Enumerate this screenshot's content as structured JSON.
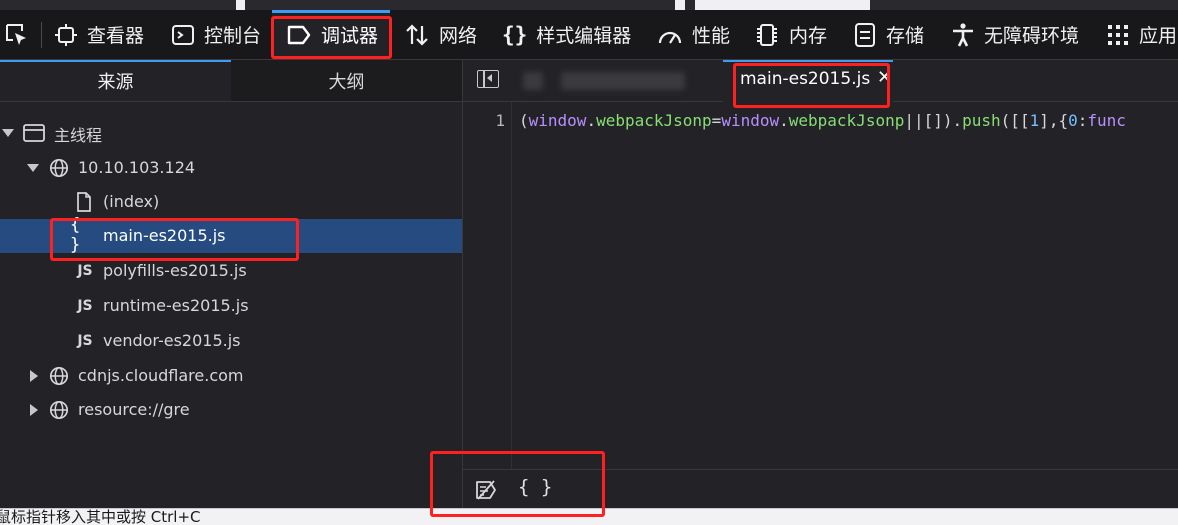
{
  "toolbar": {
    "tabs": [
      {
        "label": "查看器",
        "icon": "inspector-icon"
      },
      {
        "label": "控制台",
        "icon": "console-icon"
      },
      {
        "label": "调试器",
        "icon": "debugger-icon",
        "selected": true
      },
      {
        "label": "网络",
        "icon": "network-icon"
      },
      {
        "label": "样式编辑器",
        "icon": "style-editor-icon"
      },
      {
        "label": "性能",
        "icon": "performance-icon"
      },
      {
        "label": "内存",
        "icon": "memory-icon"
      },
      {
        "label": "存储",
        "icon": "storage-icon"
      },
      {
        "label": "无障碍环境",
        "icon": "accessibility-icon"
      },
      {
        "label": "应用",
        "icon": "application-icon"
      }
    ],
    "accent_color": "#3e9cf4"
  },
  "left_panel": {
    "tabs": [
      {
        "label": "来源",
        "active": true
      },
      {
        "label": "大纲",
        "active": false
      }
    ],
    "tree": [
      {
        "label": "主线程",
        "icon": "window-icon",
        "expanded": true
      },
      {
        "label": "10.10.103.124",
        "icon": "globe-icon",
        "expanded": true
      },
      {
        "label": "(index)",
        "icon": "file-icon"
      },
      {
        "label": "main-es2015.js",
        "icon": "braces-icon",
        "selected": true
      },
      {
        "label": "polyfills-es2015.js",
        "icon": "js-icon"
      },
      {
        "label": "runtime-es2015.js",
        "icon": "js-icon"
      },
      {
        "label": "vendor-es2015.js",
        "icon": "js-icon"
      },
      {
        "label": "cdnjs.cloudflare.com",
        "icon": "globe-icon",
        "expanded": false
      },
      {
        "label": "resource://gre",
        "icon": "globe-icon",
        "expanded": false
      }
    ],
    "js_badge": "JS",
    "braces_glyph": "{ }"
  },
  "editor": {
    "active_tab": "main-es2015.js",
    "close_glyph": "✕",
    "line_number": "1",
    "code": {
      "p1": "(",
      "kw1": "window",
      "d1": ".",
      "prop1": "webpackJsonp",
      "eq": "=",
      "kw2": "window",
      "d2": ".",
      "prop2": "webpackJsonp",
      "or": "||[]).",
      "push": "push",
      "p2": "([[",
      "num": "1",
      "p3": "],{",
      "num2": "0",
      "colon": ":",
      "func": "func"
    }
  },
  "statusbar": {
    "pretty_print_label": "{ }"
  },
  "bottom_bar": {
    "text": "鼠标指针移入其中或按 Ctrl+C"
  }
}
